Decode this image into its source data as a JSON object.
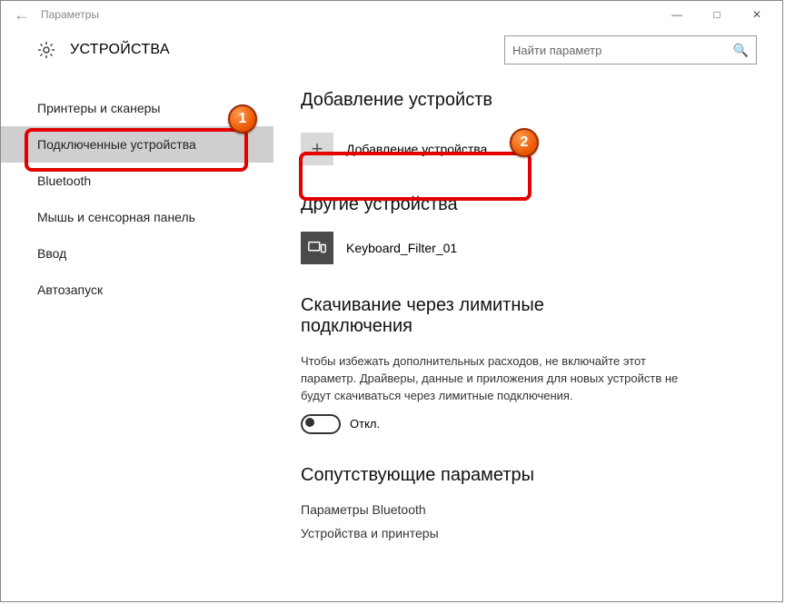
{
  "window": {
    "title": "Параметры"
  },
  "header": {
    "heading": "УСТРОЙСТВА",
    "search_placeholder": "Найти параметр"
  },
  "sidebar": {
    "items": [
      {
        "label": "Принтеры и сканеры"
      },
      {
        "label": "Подключенные устройства"
      },
      {
        "label": "Bluetooth"
      },
      {
        "label": "Мышь и сенсорная панель"
      },
      {
        "label": "Ввод"
      },
      {
        "label": "Автозапуск"
      }
    ],
    "selected_index": 1
  },
  "content": {
    "add_heading": "Добавление устройств",
    "add_button": "Добавление устройства",
    "other_heading": "Другие устройства",
    "device_name": "Keyboard_Filter_01",
    "metered_heading": "Скачивание через лимитные подключения",
    "metered_text": "Чтобы избежать дополнительных расходов, не включайте этот параметр. Драйверы, данные и приложения для новых устройств не будут скачиваться через лимитные подключения.",
    "toggle_label": "Откл.",
    "related_heading": "Сопутствующие параметры",
    "link_bluetooth": "Параметры Bluetooth",
    "link_devices": "Устройства и принтеры"
  },
  "annotations": {
    "badge1": "1",
    "badge2": "2"
  }
}
